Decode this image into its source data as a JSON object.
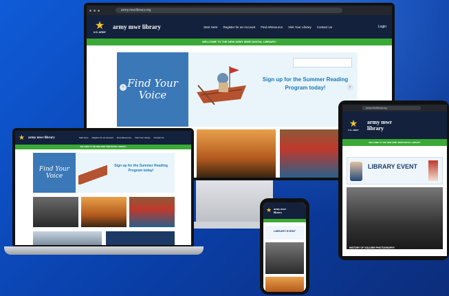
{
  "site": {
    "url": "army.mwrlibrary.org",
    "org_label": "U.S. ARMY",
    "logo_text": "army mwr library",
    "nav_items": [
      "Start Here",
      "Register for an Account",
      "Find eResource",
      "Visit Your Library",
      "Contact Us"
    ],
    "login_label": "Login",
    "welcome_banner": "WELCOME TO THE NEW ARMY MWR DIGITAL LIBRARY!",
    "hero_title": "Find Your Voice",
    "hero_promo": "Sign up for the Summer Reading Program today!",
    "library_event": "LIBRARY EVENT",
    "photo_caption": "HISTORY OF SOLDIER PHOTOGRAPHY"
  },
  "colors": {
    "navy": "#14213d",
    "green": "#3aa935",
    "hero_blue": "#3b78b8",
    "promo_blue": "#1a78b6",
    "background": "#0f5bd8"
  }
}
